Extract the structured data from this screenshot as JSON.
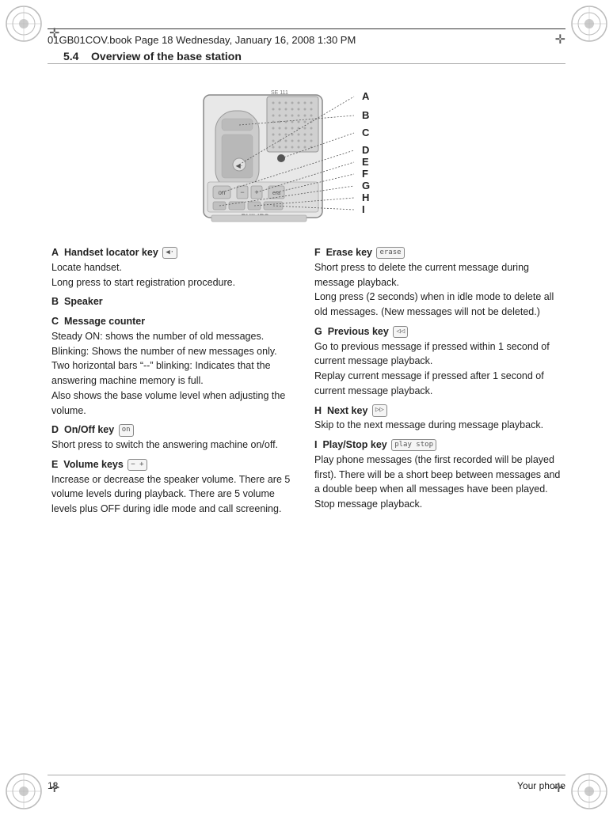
{
  "header": {
    "text": "01GB01COV.book  Page 18  Wednesday, January 16, 2008  1:30 PM"
  },
  "section": {
    "number": "5.4",
    "title": "Overview of the base station"
  },
  "letters": [
    "A",
    "B",
    "C",
    "D",
    "E",
    "F",
    "G",
    "H",
    "I"
  ],
  "left_column": [
    {
      "letter": "A",
      "heading": "Handset locator key",
      "icon": "◀·",
      "paragraphs": [
        "Locate handset.",
        "Long press to start registration procedure."
      ]
    },
    {
      "letter": "B",
      "heading": "Speaker",
      "paragraphs": []
    },
    {
      "letter": "C",
      "heading": "Message counter",
      "paragraphs": [
        "Steady ON: shows the number of old messages.",
        "Blinking: Shows the number of new messages only.",
        "Two horizontal bars \"--\" blinking: Indicates that the answering machine memory is full.",
        "Also shows the base volume level when adjusting the volume."
      ]
    },
    {
      "letter": "D",
      "heading": "On/Off key",
      "icon": "⊟",
      "paragraphs": [
        "Short press to switch the answering machine on/off."
      ]
    },
    {
      "letter": "E",
      "heading": "Volume keys",
      "icon": "− +",
      "paragraphs": [
        "Increase or decrease the speaker volume. There are 5 volume levels during playback. There are 5 volume levels plus OFF during idle mode and call screening."
      ]
    }
  ],
  "right_column": [
    {
      "letter": "F",
      "heading": "Erase key",
      "icon": "erase",
      "paragraphs": [
        "Short press to delete the current message during message playback.",
        "Long press (2 seconds) when in idle mode to delete all old messages. (New messages will not be deleted.)"
      ]
    },
    {
      "letter": "G",
      "heading": "Previous key",
      "icon": "prev",
      "paragraphs": [
        "Go to previous message if pressed within 1 second of current message playback.",
        "Replay current message if pressed after 1 second of current message playback."
      ]
    },
    {
      "letter": "H",
      "heading": "Next key",
      "icon": "▷▷",
      "paragraphs": [
        "Skip to the next message during message playback."
      ]
    },
    {
      "letter": "I",
      "heading": "Play/Stop key",
      "icon": "play stop",
      "paragraphs": [
        "Play phone messages (the first recorded will be played first). There will be a short beep between messages and a double beep when all messages have been played.",
        "Stop message playback."
      ]
    }
  ],
  "footer": {
    "page_number": "18",
    "right_text": "Your phone"
  }
}
